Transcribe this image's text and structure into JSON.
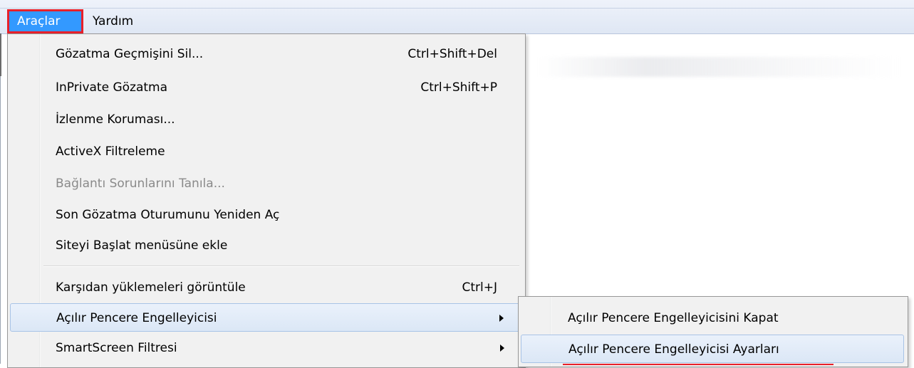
{
  "menubar": {
    "items": [
      {
        "label": "Araçlar",
        "active": true
      },
      {
        "label": "Yardım",
        "active": false
      }
    ],
    "highlight_color": "#3399ff",
    "callout_color": "#e8202a"
  },
  "tools_menu": {
    "items": [
      {
        "label": "Gözatma Geçmişini Sil...",
        "shortcut": "Ctrl+Shift+Del"
      },
      {
        "label": "InPrivate Gözatma",
        "shortcut": "Ctrl+Shift+P"
      },
      {
        "label": "İzlenme Koruması..."
      },
      {
        "label": "ActiveX Filtreleme"
      },
      {
        "label": "Bağlantı Sorunlarını Tanıla...",
        "disabled": true
      },
      {
        "label": "Son Gözatma Oturumunu Yeniden Aç"
      },
      {
        "label": "Siteyi Başlat menüsüne ekle"
      },
      {
        "label": "Karşıdan yüklemeleri görüntüle",
        "shortcut": "Ctrl+J"
      },
      {
        "label": "Açılır Pencere Engelleyicisi",
        "submenu": true,
        "highlighted": true
      },
      {
        "label": "SmartScreen Filtresi",
        "submenu": true
      }
    ]
  },
  "popup_blocker_submenu": {
    "items": [
      {
        "label": "Açılır Pencere Engelleyicisini Kapat"
      },
      {
        "label": "Açılır Pencere Engelleyicisi Ayarları",
        "highlighted": true
      }
    ]
  }
}
